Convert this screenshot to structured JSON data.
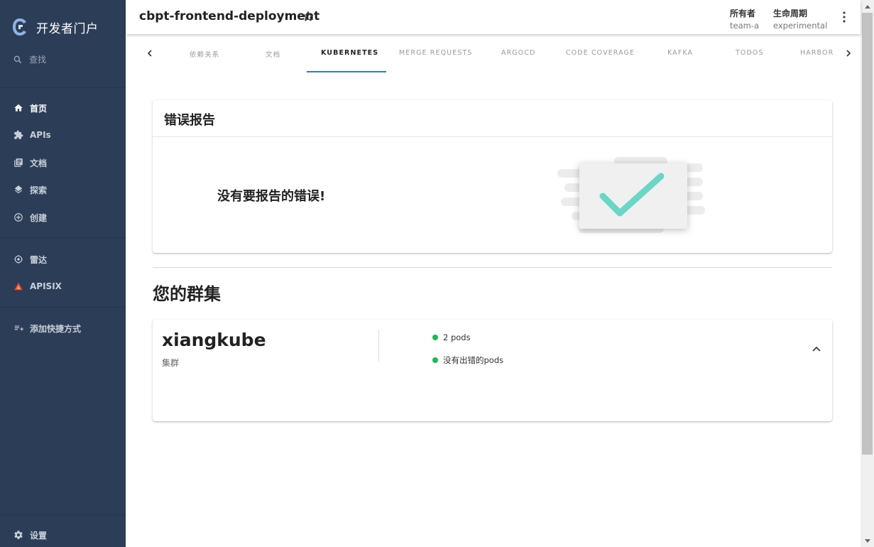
{
  "app": {
    "title": "开发者门户"
  },
  "sidebar": {
    "search_label": "查找",
    "items": [
      {
        "label": "首页",
        "icon": "home-icon",
        "active": true
      },
      {
        "label": "APIs",
        "icon": "puzzle-icon"
      },
      {
        "label": "文档",
        "icon": "library-icon"
      },
      {
        "label": "探索",
        "icon": "layers-icon"
      },
      {
        "label": "创建",
        "icon": "add-circle-icon"
      },
      {
        "label": "雷达",
        "icon": "radar-icon"
      },
      {
        "label": "APISIX",
        "icon": "apisix-icon"
      },
      {
        "label": "添加快捷方式",
        "icon": "playlist-add-icon"
      }
    ],
    "settings_label": "设置"
  },
  "header": {
    "title": "cbpt-frontend-deployment",
    "owner_label": "所有者",
    "owner_value": "team-a",
    "lifecycle_label": "生命周期",
    "lifecycle_value": "experimental"
  },
  "tabs": [
    {
      "label": "依赖关系"
    },
    {
      "label": "文档"
    },
    {
      "label": "KUBERNETES",
      "active": true
    },
    {
      "label": "MERGE REQUESTS"
    },
    {
      "label": "ARGOCD"
    },
    {
      "label": "CODE COVERAGE"
    },
    {
      "label": "KAFKA"
    },
    {
      "label": "TODOS"
    },
    {
      "label": "HARBOR"
    }
  ],
  "error_report": {
    "title": "错误报告",
    "message": "没有要报告的错误!"
  },
  "clusters": {
    "title": "您的群集",
    "items": [
      {
        "name": "xiangkube",
        "subtitle": "集群",
        "pods_status": "2 pods",
        "error_status": "没有出错的pods"
      }
    ]
  },
  "colors": {
    "sidebar_bg": "#2c3e57",
    "tab_active_indicator": "#2d7bcf",
    "status_ok": "#1db954",
    "check_mark": "#6ad6c5"
  }
}
